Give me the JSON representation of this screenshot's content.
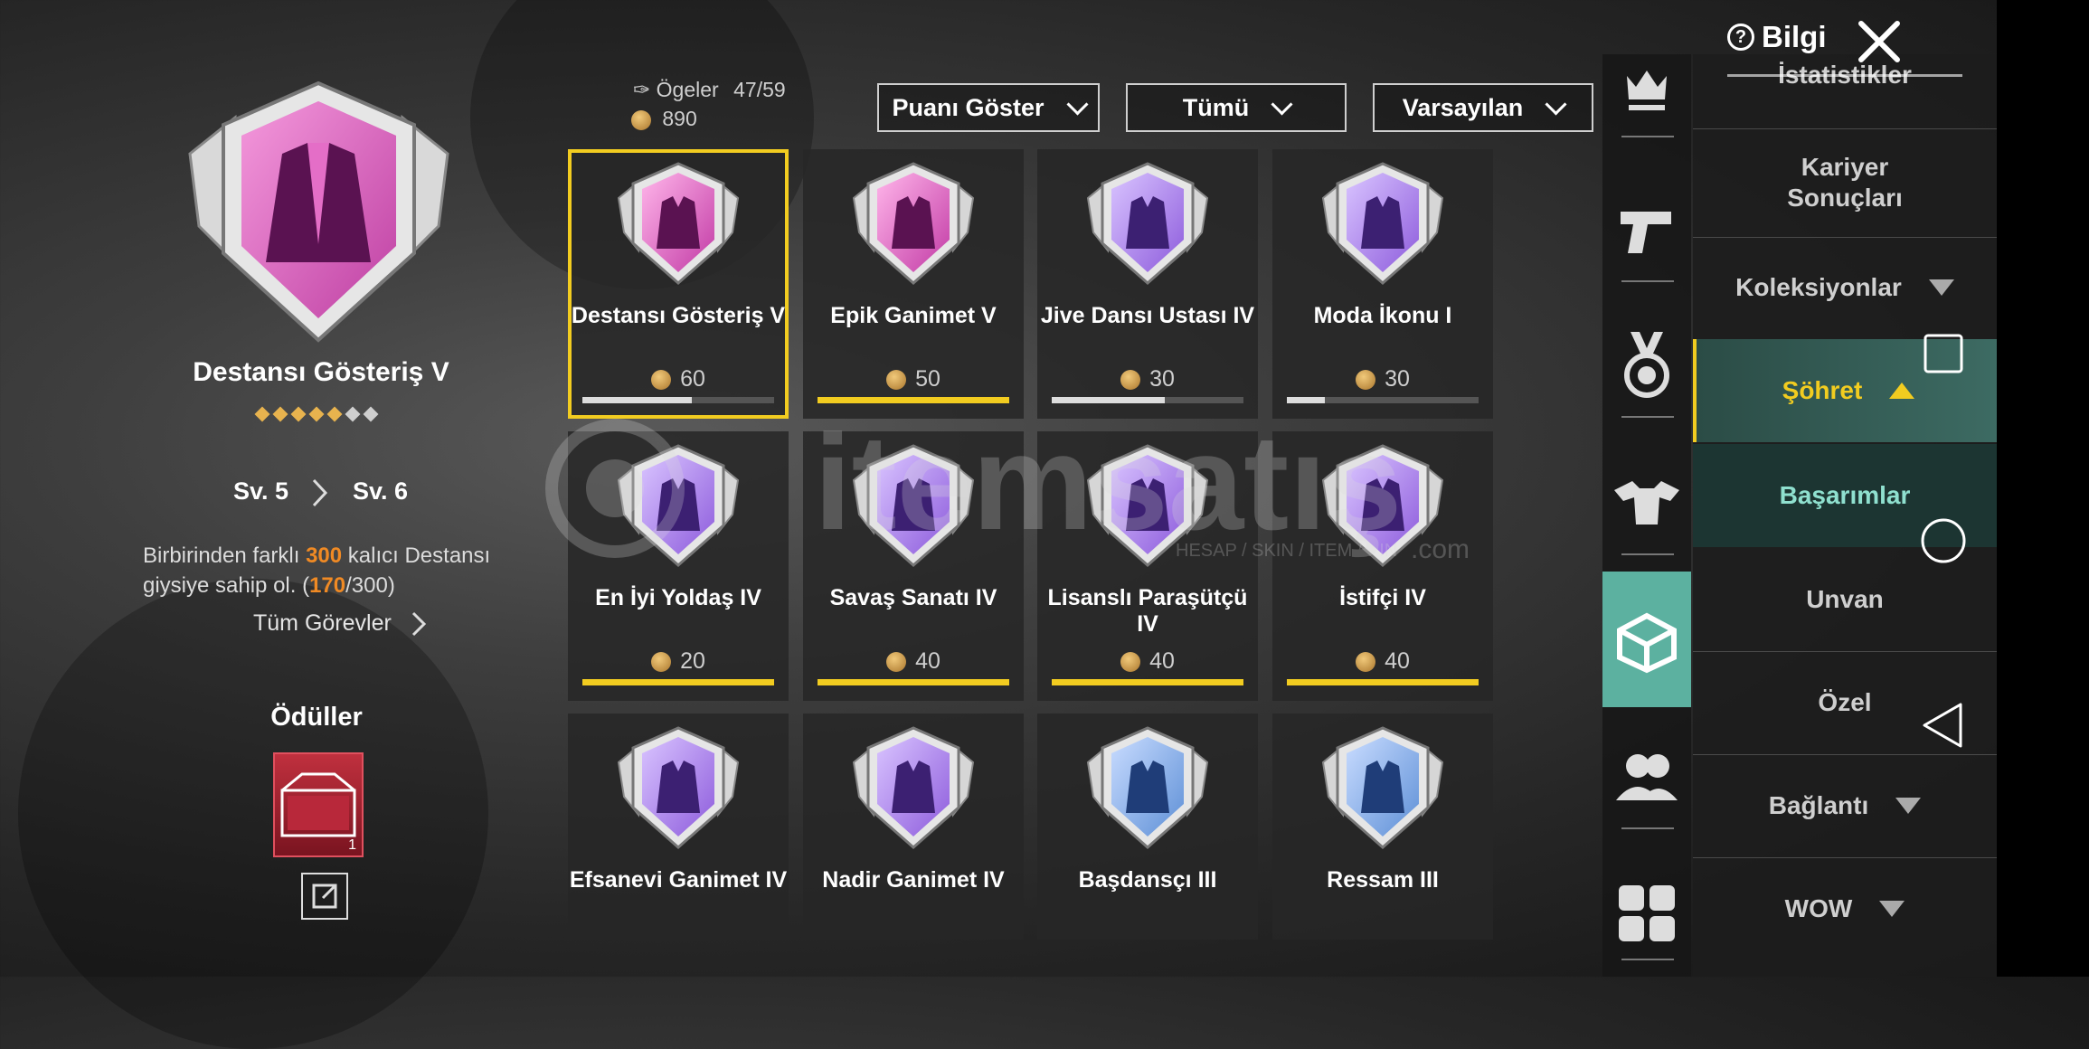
{
  "header": {
    "info_label": "Bilgi"
  },
  "selected": {
    "title": "Destansı Gösteriş V",
    "level_from": "Sv. 5",
    "level_to": "Sv. 6",
    "desc_pre": "Birbirinden farklı ",
    "desc_hl": "300",
    "desc_mid": " kalıcı Destansı",
    "desc_line2_pre": "giysiye sahip ol. (",
    "desc_progress": "170",
    "desc_total": "/300)",
    "all_tasks": "Tüm Görevler",
    "stars_filled": 5,
    "stars_total": 7
  },
  "rewards": {
    "title": "Ödüller",
    "count": "1"
  },
  "stats": {
    "items_label": "Ögeler",
    "items_value": "47/59",
    "points": "890"
  },
  "filters": [
    {
      "label": "Puanı Göster"
    },
    {
      "label": "Tümü"
    },
    {
      "label": "Varsayılan"
    }
  ],
  "grid": [
    {
      "name": "Destansı Gösteriş V",
      "points": "60",
      "progress": 0.57,
      "icon": "jacket-icon",
      "color": "pink"
    },
    {
      "name": "Epik Ganimet V",
      "points": "50",
      "progress": 1.0,
      "icon": "coat-icon",
      "color": "pink"
    },
    {
      "name": "Jive Dansı Ustası IV",
      "points": "30",
      "progress": 0.59,
      "icon": "dancer-icon",
      "color": "violet"
    },
    {
      "name": "Moda İkonu I",
      "points": "30",
      "progress": 0.2,
      "icon": "diamond-icon",
      "color": "violet"
    },
    {
      "name": "En İyi Yoldaş IV",
      "points": "20",
      "progress": 1.0,
      "icon": "eagle-icon",
      "color": "violet"
    },
    {
      "name": "Savaş Sanatı IV",
      "points": "40",
      "progress": 1.0,
      "icon": "claw-icon",
      "color": "violet"
    },
    {
      "name": "Lisanslı Paraşütçü IV",
      "points": "40",
      "progress": 1.0,
      "icon": "parachute-icon",
      "color": "violet"
    },
    {
      "name": "İstifçi IV",
      "points": "40",
      "progress": 1.0,
      "icon": "locker-icon",
      "color": "violet"
    },
    {
      "name": "Efsanevi Ganimet IV",
      "points": "",
      "progress": 0,
      "icon": "armor-icon",
      "color": "violet"
    },
    {
      "name": "Nadir Ganimet IV",
      "points": "",
      "progress": 0,
      "icon": "coat-icon",
      "color": "violet"
    },
    {
      "name": "Başdansçı III",
      "points": "",
      "progress": 0,
      "icon": "dancer-icon",
      "color": "blue"
    },
    {
      "name": "Ressam III",
      "points": "",
      "progress": 0,
      "icon": "crosshair-icon",
      "color": "blue"
    }
  ],
  "menu": {
    "top_partial": "İstatistikler",
    "career": "Kariyer Sonuçları",
    "collections": "Koleksiyonlar",
    "fame": "Şöhret",
    "achievements": "Başarımlar",
    "title": "Unvan",
    "special": "Özel",
    "connection": "Bağlantı",
    "wow": "WOW"
  },
  "watermark": {
    "brand": "itemsatış",
    "tagline": "HESAP / SKIN / ITEM / PIN",
    "suffix": ".com"
  },
  "colors": {
    "accent": "#f2cc20",
    "teal": "#5cb1a0",
    "highlight": "#f08a24"
  }
}
